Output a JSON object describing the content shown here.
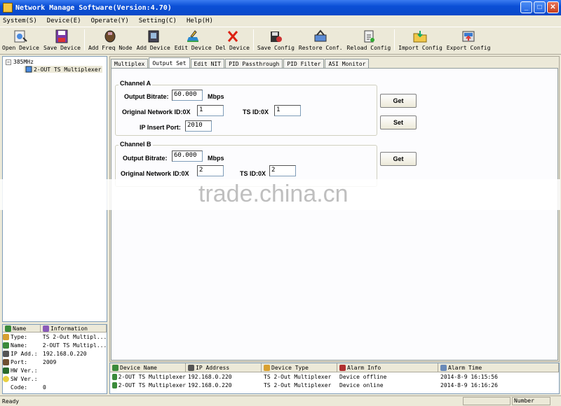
{
  "window": {
    "title": "Network Manage Software(Version:4.70)"
  },
  "menu": [
    "System(S)",
    "Device(E)",
    "Operate(Y)",
    "Setting(C)",
    "Help(H)"
  ],
  "toolbar": [
    {
      "label": "Open Device",
      "icon": "open-device-icon"
    },
    {
      "label": "Save Device",
      "icon": "save-device-icon"
    },
    {
      "label": "Add Freq Node",
      "icon": "add-freq-node-icon"
    },
    {
      "label": "Add Device",
      "icon": "add-device-icon"
    },
    {
      "label": "Edit Device",
      "icon": "edit-device-icon"
    },
    {
      "label": "Del Device",
      "icon": "del-device-icon"
    },
    {
      "label": "Save Config",
      "icon": "save-config-icon"
    },
    {
      "label": "Restore Conf.",
      "icon": "restore-conf-icon"
    },
    {
      "label": "Reload Config",
      "icon": "reload-config-icon"
    },
    {
      "label": "Import Config",
      "icon": "import-config-icon"
    },
    {
      "label": "Export Config",
      "icon": "export-config-icon"
    }
  ],
  "tree": {
    "root": "385MHz",
    "child": "2-OUT TS Multiplexer"
  },
  "info": {
    "headers": [
      "Name",
      "Information"
    ],
    "rows": [
      {
        "key": "Type:",
        "value": "TS 2-Out Multipl..."
      },
      {
        "key": "Name:",
        "value": "2-OUT TS Multipl..."
      },
      {
        "key": "IP Add.:",
        "value": "192.168.0.220"
      },
      {
        "key": "Port:",
        "value": "2009"
      },
      {
        "key": "HW Ver.:",
        "value": ""
      },
      {
        "key": "SW Ver.:",
        "value": ""
      },
      {
        "key": "Code:",
        "value": "0"
      }
    ]
  },
  "tabs": [
    "Multiplex",
    "Output Set",
    "Edit NIT",
    "PID Passthrough",
    "PID Filter",
    "ASI Monitor"
  ],
  "channel_a": {
    "title": "Channel A",
    "bitrate_label": "Output Bitrate:",
    "bitrate": "60.000",
    "unit": "Mbps",
    "onid_label": "Original Network ID:0X",
    "onid": "1",
    "tsid_label": "TS ID:0X",
    "tsid": "1",
    "port_label": "IP Insert Port:",
    "port": "2010"
  },
  "channel_b": {
    "title": "Channel B",
    "bitrate_label": "Output Bitrate:",
    "bitrate": "60.000",
    "unit": "Mbps",
    "onid_label": "Original Network ID:0X",
    "onid": "2",
    "tsid_label": "TS ID:0X",
    "tsid": "2"
  },
  "buttons": {
    "get": "Get",
    "set": "Set"
  },
  "watermark": "trade.china.cn",
  "alarms": {
    "headers": [
      "Device Name",
      "IP Address",
      "Device Type",
      "Alarm Info",
      "Alarm Time"
    ],
    "rows": [
      [
        "2-OUT TS Multiplexer",
        "192.168.0.220",
        "TS 2-Out Multiplexer",
        "Device offline",
        "2014-8-9 16:15:56"
      ],
      [
        "2-OUT TS Multiplexer",
        "192.168.0.220",
        "TS 2-Out Multiplexer",
        "Device online",
        "2014-8-9 16:16:26"
      ]
    ]
  },
  "status": {
    "left": "Ready",
    "right": "Number"
  }
}
